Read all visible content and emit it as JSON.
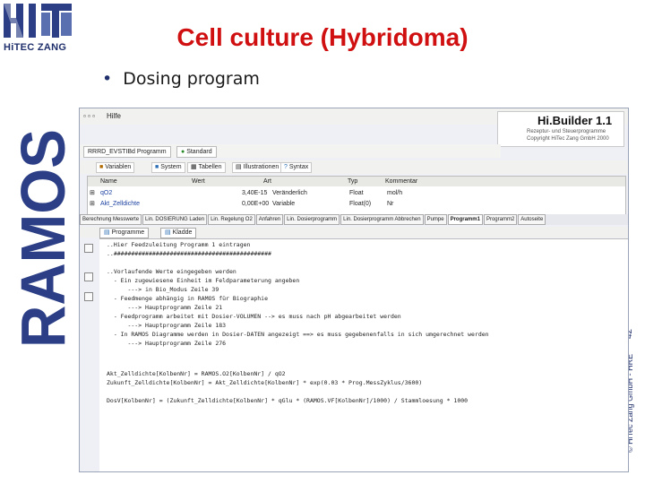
{
  "logo": {
    "text": "HiTEC ZANG"
  },
  "brand": {
    "text": "RAMOS"
  },
  "slide": {
    "title": "Cell culture (Hybridoma)",
    "bullet": "Dosing program",
    "page_number": "42",
    "side_text": "© HiTec Zang GmbH - HRE"
  },
  "app": {
    "menu": [
      "Hilfe"
    ],
    "header_title": "Hi.Builder 1.1",
    "header_sub": [
      "Rezeptur- und Steuerprogramme",
      "Copyright HiTec Zang GmbH 2000"
    ],
    "top_tabs": [
      "RRRD_EVSTIBd Programm",
      "Standard"
    ],
    "toolbar_tabs": [
      "Variablen",
      "System",
      "Tabellen",
      "Illustrationen",
      "Syntax"
    ],
    "var_table": {
      "headers": [
        "Name",
        "Wert",
        "Art",
        "Typ",
        "Kommentar"
      ],
      "rows": [
        [
          "qO2",
          "3,40E-15",
          "Veränderlich",
          "Float",
          "mol/h"
        ],
        [
          "Akt_Zelldichte",
          "0,00E+00",
          "Variable",
          "Float(0)",
          "Nr"
        ]
      ]
    },
    "section_tabs": [
      "Berechnung Messwerte",
      "Lin. DOSIERUNG Laden",
      "Lin. Regelung O2",
      "Anfahren",
      "Lin. Dosierprogramm",
      "Lin. Dosierprogramm Abbrechen",
      "Pumpe",
      "Programm1",
      "Programm2",
      "Autoseite"
    ],
    "sub_tabs": [
      "Programme",
      "Kladde"
    ],
    "code_lines": [
      "..Hier Feedzuleitung Programm 1 eintragen",
      "..#############################################",
      "",
      "..Vorlaufende Werte eingegeben werden",
      "  - Ein zugewiesene Einheit im Feldparameterung angeben",
      "      ---> in Bio_Modus Zeile 39",
      "  - Feedmenge abhängig in RAMOS für Biographie",
      "      ---> Hauptprogramm Zeile 21",
      "  - Feedprogramm arbeitet mit Dosier-VOLUMEN --> es muss nach pH abgearbeitet werden",
      "      ---> Hauptprogramm Zeile 183",
      "  - In RAMOS Diagramme werden in Dosier-DATEN angezeigt ==> es muss gegebenenfalls in sich umgerechnet werden",
      "      ---> Hauptprogramm Zeile 276",
      "",
      "",
      "Akt_Zelldichte[KolbenNr] = RAMOS.O2[KolbenNr] / qO2",
      "Zukunft_Zelldichte[KolbenNr] = Akt_Zelldichte[KolbenNr] * exp(0.03 * Prog.MessZyklus/3600)",
      "",
      "DosV[KolbenNr] = (Zukunft_Zelldichte[KolbenNr] * qGlu * (RAMOS.VF[KolbenNr]/1000) / Stammloesung * 1000"
    ]
  }
}
